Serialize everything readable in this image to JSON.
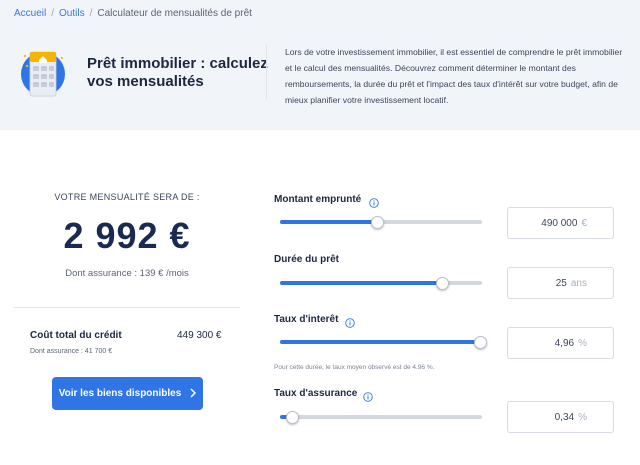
{
  "breadcrumb": {
    "items": [
      "Accueil",
      "Outils",
      "Calculateur de mensualités de prêt"
    ],
    "separator": "/"
  },
  "hero": {
    "icon": "calculator-house-icon",
    "title": "Prêt immobilier : calculez vos mensualités",
    "description": "Lors de votre investissement immobilier, il est essentiel de comprendre le prêt immobilier et le calcul des mensualités. Découvrez comment déterminer le montant des remboursements, la durée du prêt et l'impact des taux d'intérêt sur votre budget, afin de mieux planifier votre investissement locatif."
  },
  "result": {
    "label": "VOTRE MENSUALITÉ SERA DE :",
    "value": "2 992 €",
    "insurance": "Dont assurance : 139 € /mois"
  },
  "cost": {
    "label": "Coût total du crédit",
    "value": "449 300 €",
    "insurance": "Dont assurance : 41 700 €"
  },
  "cta": {
    "label": "Voir les biens disponibles",
    "icon": "chevron-right-icon"
  },
  "fields": {
    "amount": {
      "label": "Montant emprunté",
      "value": "490 000",
      "unit": "€",
      "level": 0.48,
      "has_info": true
    },
    "duration": {
      "label": "Durée du prêt",
      "value": "25",
      "unit": "ans",
      "level": 0.8,
      "has_info": false
    },
    "rate": {
      "label": "Taux d'interêt",
      "value": "4,96",
      "unit": "%",
      "level": 0.99,
      "has_info": true
    },
    "insurance": {
      "label": "Taux d'assurance",
      "value": "0,34",
      "unit": "%",
      "level": 0.06,
      "has_info": true
    }
  },
  "rate_hint": "Pour cette durée, le taux moyen observé est de 4.96 %.",
  "colors": {
    "accent": "#2f75e6",
    "band": "#f1f4f9",
    "heading": "#1a2a52"
  }
}
